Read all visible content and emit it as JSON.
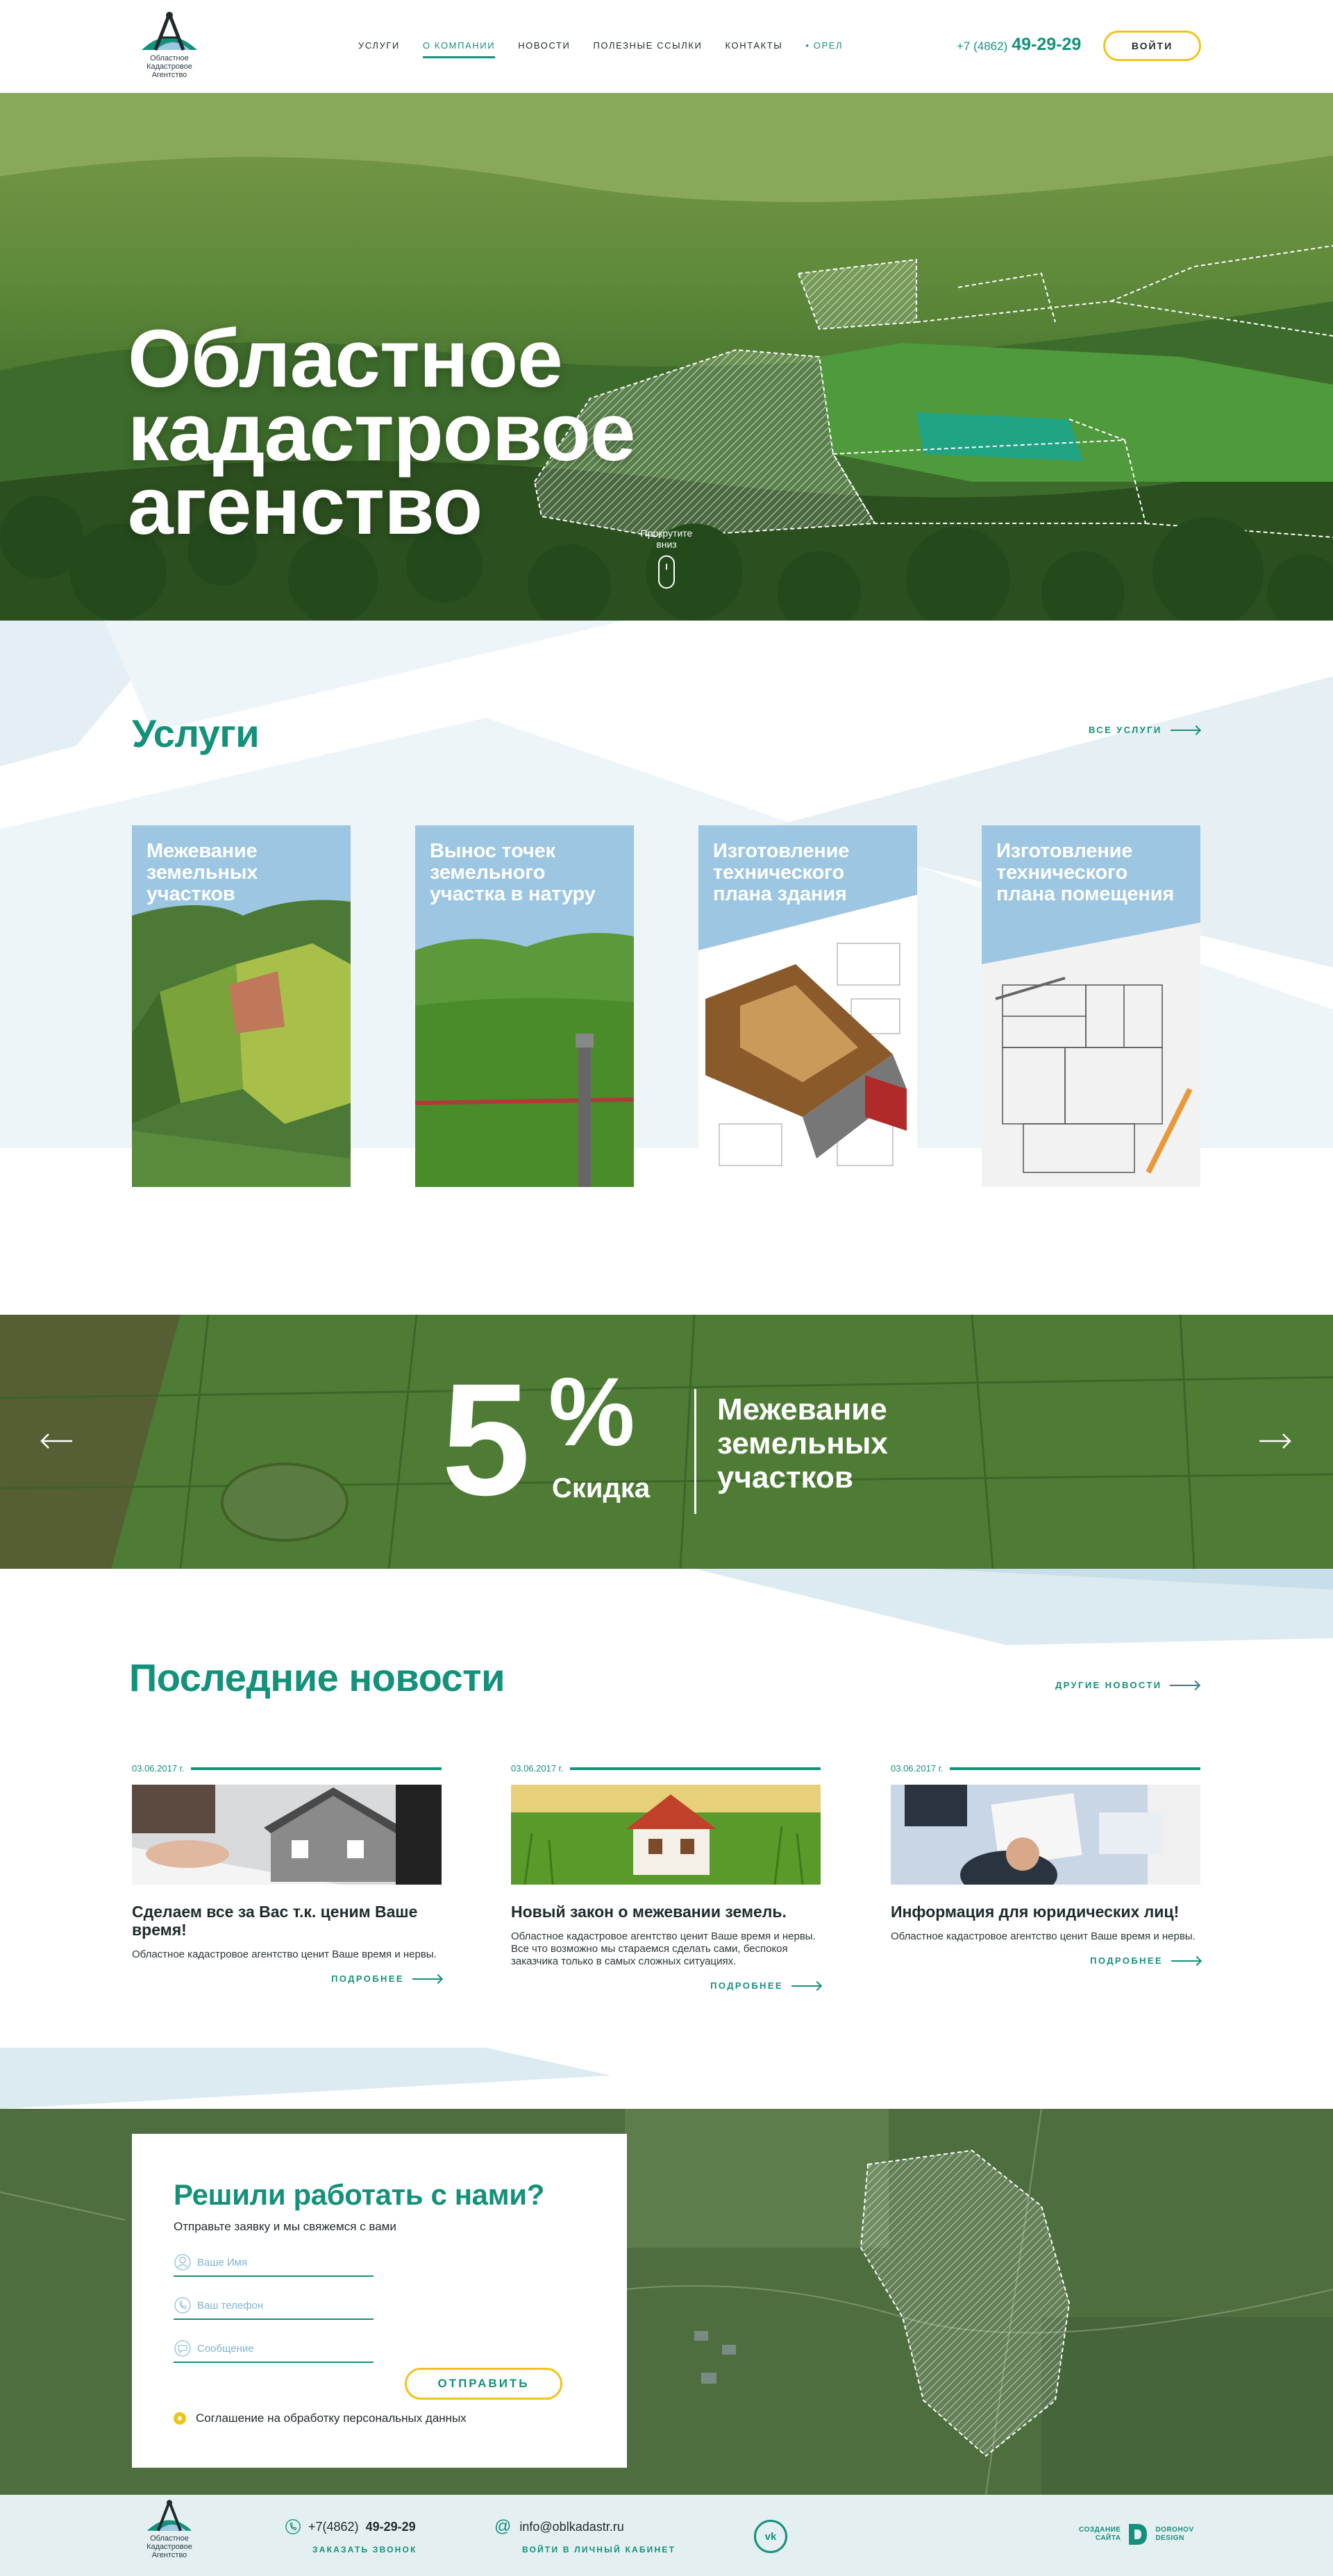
{
  "header": {
    "logo_lines": [
      "Областное",
      "Кадастровое",
      "Агентство"
    ],
    "nav": [
      {
        "label": "УСЛУГИ"
      },
      {
        "label": "О КОМПАНИИ"
      },
      {
        "label": "НОВОСТИ"
      },
      {
        "label": "ПОЛЕЗНЫЕ ССЫЛКИ"
      },
      {
        "label": "КОНТАКТЫ"
      },
      {
        "label": "ОРЕЛ"
      }
    ],
    "phone_code": "+7 (4862)",
    "phone_number": "49-29-29",
    "login_label": "ВОЙТИ"
  },
  "hero": {
    "title": "Областное кадастровое агенство",
    "scroll_hint": "Прокрутите вниз"
  },
  "services": {
    "title": "Услуги",
    "all_link": "ВСЕ УСЛУГИ",
    "cards": [
      {
        "title": "Межевание земельных участков"
      },
      {
        "title": "Вынос точек земельного участка в натуру"
      },
      {
        "title": "Изготовление технического плана здания"
      },
      {
        "title": "Изготовление технического плана помещения"
      }
    ]
  },
  "promo": {
    "percent": "5",
    "percent_sign": "%",
    "discount_label": "Скидка",
    "text": "Межевание земельных участков",
    "discount_value_percent": 5
  },
  "news": {
    "title": "Последние новости",
    "other_link": "ДРУГИЕ НОВОСТИ",
    "items": [
      {
        "date": "03.06.2017 г.",
        "title": "Сделаем все за Вас т.к. ценим Ваше время!",
        "text": "Областное кадастровое агентство ценит Ваше время и нервы.",
        "more": "ПОДРОБНЕЕ"
      },
      {
        "date": "03.06.2017 г.",
        "title": "Новый закон о межевании земель.",
        "text": "Областное кадастровое агентство ценит Ваше время и нервы. Все что возможно мы стараемся сделать сами, беспокоя заказчика только в самых сложных ситуациях.",
        "more": "ПОДРОБНЕЕ"
      },
      {
        "date": "03.06.2017 г.",
        "title": "Информация для юридических лиц!",
        "text": "Областное кадастровое агентство ценит Ваше время и нервы.",
        "more": "ПОДРОБНЕЕ"
      }
    ]
  },
  "contact": {
    "title": "Решили работать с нами?",
    "subtitle": "Отправьте заявку и мы свяжемся с вами",
    "name_placeholder": "Ваше Имя",
    "phone_placeholder": "Ваш телефон",
    "message_placeholder": "Сообщение",
    "send_label": "ОТПРАВИТЬ",
    "agreement": "Соглашение на обработку персональных данных"
  },
  "footer": {
    "logo_lines": [
      "Областное",
      "Кадастровое",
      "Агентство"
    ],
    "phone_code": "+7(4862)",
    "phone_number": "49-29-29",
    "call_link": "ЗАКАЗАТЬ ЗВОНОК",
    "email": "info@oblkadastr.ru",
    "cabinet_link": "ВОЙТИ В ЛИЧНЫЙ КАБИНЕТ",
    "vk_label": "vk",
    "made_by_left": [
      "СОЗДАНИЕ",
      "САЙТА"
    ],
    "made_by_right": [
      "DOROHOV",
      "DESIGN"
    ]
  },
  "colors": {
    "brand_green": "#13917a",
    "accent_yellow": "#f0c419",
    "light_blue": "#9cc6e1"
  }
}
